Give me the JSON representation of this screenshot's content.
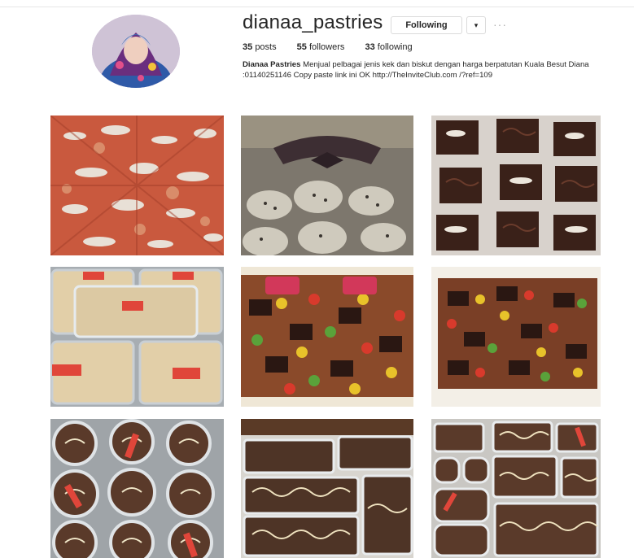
{
  "profile": {
    "username": "dianaa_pastries",
    "follow_label": "Following",
    "dropdown_glyph": "▾",
    "more_glyph": "···",
    "stats": {
      "posts_count": "35",
      "posts_label": "posts",
      "followers_count": "55",
      "followers_label": "followers",
      "following_count": "33",
      "following_label": "following"
    },
    "bio": {
      "name": "Dianaa Pastries",
      "text": "Menjual pelbagai jenis kek dan biskut dengan harga berpatutan Kuala Besut Diana :01140251146 Copy paste link ini OK http://TheInviteClub.com /?ref=109"
    }
  },
  "posts": [
    {
      "subject": "pizza"
    },
    {
      "subject": "cookies-in-jar"
    },
    {
      "subject": "almond-brownies"
    },
    {
      "subject": "boxed-pastries"
    },
    {
      "subject": "chocolate-candy-cake"
    },
    {
      "subject": "chocolate-candy-cake-2"
    },
    {
      "subject": "dessert-cups"
    },
    {
      "subject": "dessert-trays"
    },
    {
      "subject": "dessert-trays-2"
    }
  ],
  "colors": {
    "button_border": "#dbdbdb",
    "text": "#262626"
  }
}
